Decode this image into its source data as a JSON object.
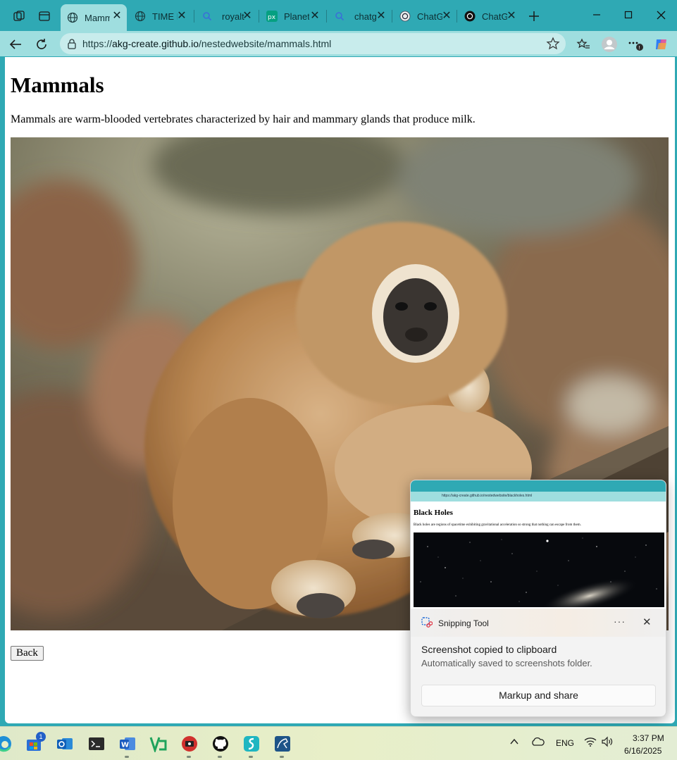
{
  "tabs": [
    {
      "title": "Mamm",
      "icon": "globe-icon",
      "active": true
    },
    {
      "title": "TIME I",
      "icon": "globe-icon",
      "active": false
    },
    {
      "title": "royalt",
      "icon": "search-icon",
      "active": false
    },
    {
      "title": "Planet",
      "icon": "pexels-icon",
      "active": false
    },
    {
      "title": "chatg",
      "icon": "search-icon",
      "active": false
    },
    {
      "title": "ChatG",
      "icon": "chatgpt-icon",
      "active": false
    },
    {
      "title": "ChatG",
      "icon": "openai-icon",
      "active": false
    }
  ],
  "address": {
    "url_prefix": "https://",
    "url_host": "akg-create.github.io",
    "url_path": "/nestedwebsite/mammals.html"
  },
  "page": {
    "title": "Mammals",
    "description": "Mammals are warm-blooded vertebrates characterized by hair and mammary glands that produce milk.",
    "back_label": "Back"
  },
  "toast": {
    "preview": {
      "title": "Black Holes",
      "description": "Black holes are regions of spacetime exhibiting gravitational acceleration so strong that nothing can escape from them.",
      "url": "https://akg-create.github.io/nestedwebsite/blackholes.html"
    },
    "app_name": "Snipping Tool",
    "more_label": "···",
    "message": "Screenshot copied to clipboard",
    "submessage": "Automatically saved to screenshots folder.",
    "action_label": "Markup and share"
  },
  "taskbar": {
    "badge_count": "1",
    "language": "ENG",
    "time": "3:37 PM",
    "date": "6/16/2025"
  },
  "colors": {
    "tab_strip": "#2fa9b4",
    "toolbar": "#9fdedf",
    "address_bar": "#c8ecec"
  }
}
